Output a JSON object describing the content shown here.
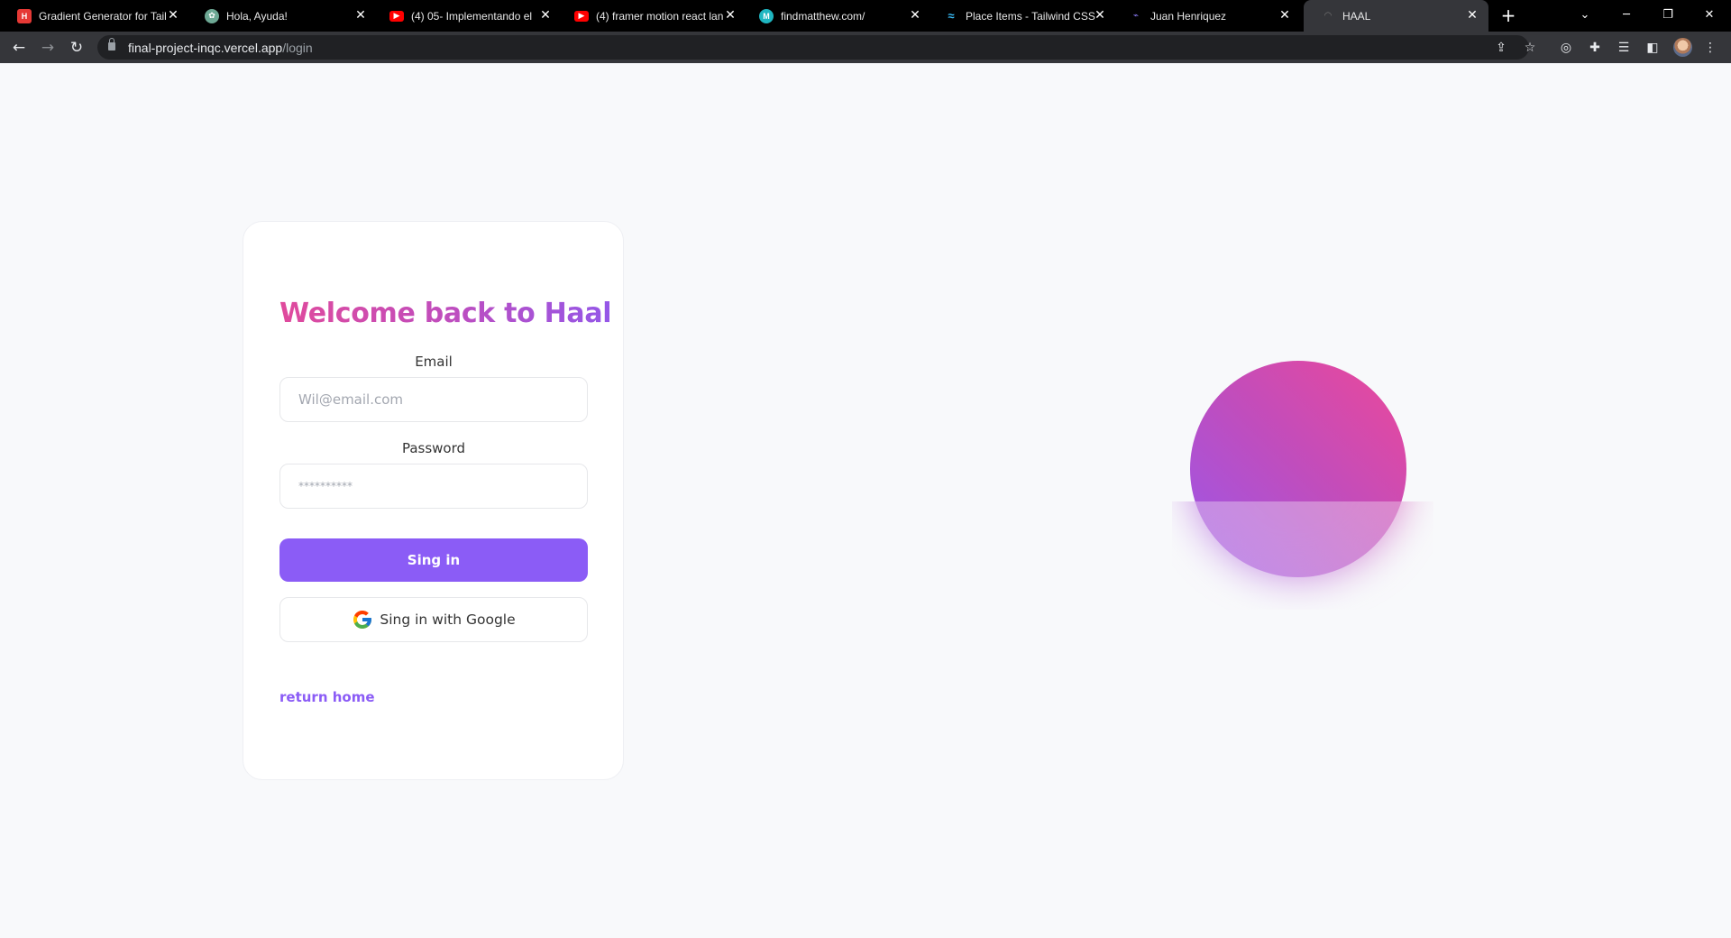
{
  "browser": {
    "tabs": [
      {
        "title": "Gradient Generator for Tail",
        "favicon": "hyperui-icon",
        "color": "#e53935"
      },
      {
        "title": "Hola, Ayuda!",
        "favicon": "chatgpt-icon",
        "color": "#6da894"
      },
      {
        "title": "(4) 05- Implementando el",
        "favicon": "youtube-icon",
        "color": "#ff0000"
      },
      {
        "title": "(4) framer motion react lan",
        "favicon": "youtube-icon",
        "color": "#ff0000"
      },
      {
        "title": "findmatthew.com/",
        "favicon": "site-icon",
        "color": "#1fb6c1"
      },
      {
        "title": "Place Items - Tailwind CSS",
        "favicon": "tailwind-icon",
        "color": "#38bdf8"
      },
      {
        "title": "Juan Henriquez",
        "favicon": "portfolio-icon",
        "color": "#6b5cf6"
      },
      {
        "title": "HAAL",
        "favicon": "haal-icon",
        "color": "#444444"
      }
    ],
    "url_host": "final-project-inqc.vercel.app",
    "url_path": "/login"
  },
  "login": {
    "title": "Welcome back to Haal",
    "email_label": "Email",
    "email_placeholder": "Wil@email.com",
    "password_label": "Password",
    "password_placeholder": "**********",
    "signin_label": "Sing in",
    "google_label": "Sing in with Google",
    "return_link": "return home"
  },
  "colors": {
    "accent": "#8b5cf6",
    "gradient_pink": "#ec4899",
    "gradient_purple": "#9457e8",
    "page_background": "#f8f9fb"
  }
}
